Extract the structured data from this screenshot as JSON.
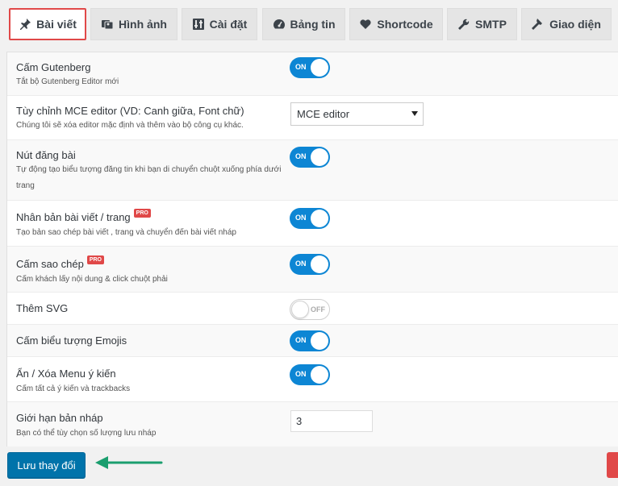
{
  "tabs": [
    {
      "label": "Bài viết",
      "icon": "pin-icon",
      "active": true
    },
    {
      "label": "Hình ảnh",
      "icon": "images-icon"
    },
    {
      "label": "Cài đặt",
      "icon": "settings-icon"
    },
    {
      "label": "Bảng tin",
      "icon": "dashboard-icon"
    },
    {
      "label": "Shortcode",
      "icon": "heart-icon"
    },
    {
      "label": "SMTP",
      "icon": "wrench-icon"
    },
    {
      "label": "Giao diện",
      "icon": "hammer-icon"
    }
  ],
  "settings": [
    {
      "label": "Cấm Gutenberg",
      "desc": "Tắt bộ Gutenberg Editor mới",
      "control": "toggle",
      "state": "ON"
    },
    {
      "label": "Tùy chỉnh MCE editor (VD: Canh giữa, Font chữ)",
      "desc": "Chúng tôi sẽ xóa editor mặc định và thêm vào bộ công cụ khác.",
      "control": "select",
      "value": "MCE editor"
    },
    {
      "label": "Nút đăng bài",
      "desc": "Tự động tạo biểu tượng đăng tin khi bạn di chuyển chuột xuống phía dưới trang",
      "control": "toggle",
      "state": "ON"
    },
    {
      "label": "Nhân bản bài viết / trang",
      "pro": "PRO",
      "desc": "Tạo bản sao chép bài viết , trang và chuyển đến bài viết nháp",
      "control": "toggle",
      "state": "ON"
    },
    {
      "label": "Cấm sao chép",
      "pro": "PRO",
      "desc": "Cấm khách lấy nội dung & click chuột phải",
      "control": "toggle",
      "state": "ON"
    },
    {
      "label": "Thêm SVG",
      "desc": "",
      "control": "toggle",
      "state": "OFF"
    },
    {
      "label": "Cấm biểu tượng Emojis",
      "desc": "",
      "control": "toggle",
      "state": "ON"
    },
    {
      "label": "Ẩn / Xóa Menu ý kiến",
      "desc": "Cấm tất cả ý kiến và trackbacks",
      "control": "toggle",
      "state": "ON"
    },
    {
      "label": "Giới hạn bản nháp",
      "desc": "Bạn có thể tùy chọn số lượng lưu nháp",
      "control": "number",
      "value": "3"
    }
  ],
  "footer": {
    "save_label": "Lưu thay đổi"
  },
  "colors": {
    "accent": "#0d86d4",
    "primary_button": "#0073aa",
    "pro_badge": "#e04848",
    "annotation_arrow": "#1a9e6e"
  }
}
